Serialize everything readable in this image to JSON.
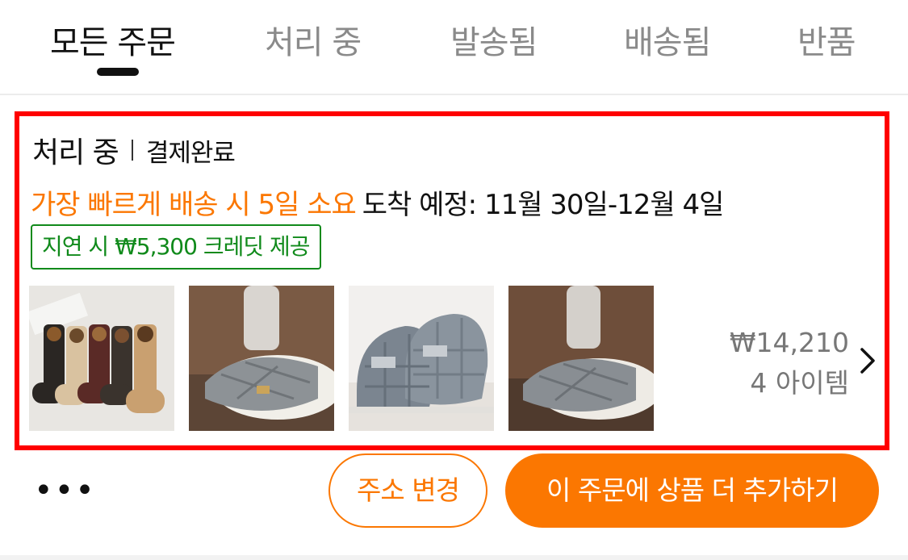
{
  "tabs": [
    {
      "label": "모든 주문",
      "active": true
    },
    {
      "label": "처리 중",
      "active": false
    },
    {
      "label": "발송됨",
      "active": false
    },
    {
      "label": "배송됨",
      "active": false
    },
    {
      "label": "반품",
      "active": false
    }
  ],
  "order": {
    "status": "처리 중",
    "payment_status": "결제완료",
    "fast_delivery_text": "가장 빠르게 배송 시 5일 소요",
    "eta_text": "도착 예정: 11월 30일-12월 4일",
    "credit_text": "지연 시 ₩5,300 크레딧 제공",
    "items": [
      {
        "icon": "socks-product-image"
      },
      {
        "icon": "slipper-worn-product-image"
      },
      {
        "icon": "slipper-pair-product-image"
      },
      {
        "icon": "slipper-worn-product-image"
      }
    ],
    "total": "₩14,210",
    "item_count": "4 아이템"
  },
  "actions": {
    "more_label": "•••",
    "change_address": "주소 변경",
    "add_items": "이 주문에 상품 더 추가하기"
  },
  "colors": {
    "accent": "#fb7701",
    "highlight_border": "#ff0000",
    "credit_green": "#108a1b"
  }
}
